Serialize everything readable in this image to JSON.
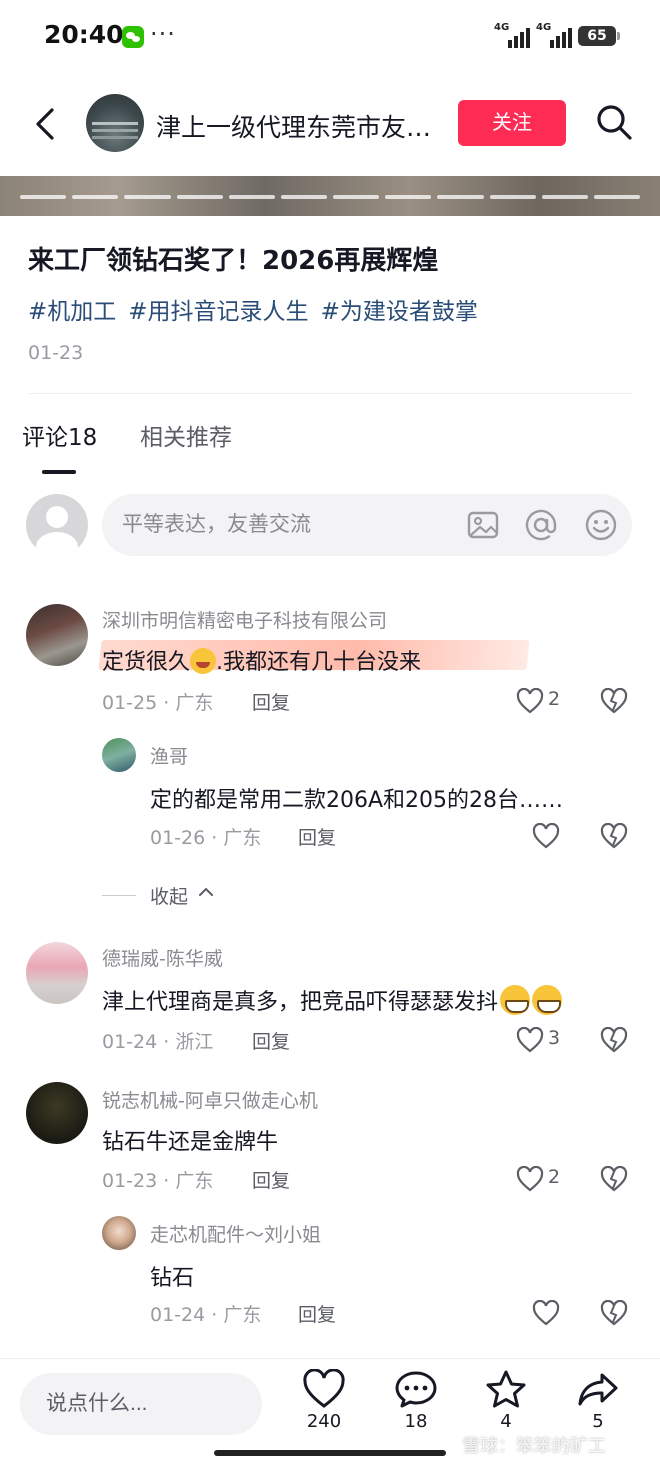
{
  "status": {
    "time": "20:40",
    "dots": "···",
    "signal_label": "4G",
    "battery": "65"
  },
  "header": {
    "title": "津上一级代理东莞市友…",
    "follow_label": "关注"
  },
  "post": {
    "title": "来工厂领钻石奖了！2026再展辉煌",
    "hashtags": [
      "#机加工",
      "#用抖音记录人生",
      "#为建设者鼓掌"
    ],
    "date": "01-23"
  },
  "tabs": {
    "comments": "评论18",
    "related": "相关推荐"
  },
  "composer": {
    "placeholder": "平等表达，友善交流"
  },
  "comments": [
    {
      "user": "深圳市明信精密电子科技有限公司",
      "text_a": "定货很久",
      "text_b": ".我都还有几十台没来",
      "date": "01-25",
      "location": "广东",
      "reply": "回复",
      "likes": "2"
    },
    {
      "user": "渔哥",
      "text": "定的都是常用二款206A和205的28台……",
      "date": "01-26",
      "location": "广东",
      "reply": "回复"
    },
    {
      "user": "德瑞威-陈华威",
      "text": "津上代理商是真多，把竞品吓得瑟瑟发抖",
      "date": "01-24",
      "location": "浙江",
      "reply": "回复",
      "likes": "3"
    },
    {
      "user": "锐志机械-阿卓只做走心机",
      "text": "钻石牛还是金牌牛",
      "date": "01-23",
      "location": "广东",
      "reply": "回复",
      "likes": "2"
    },
    {
      "user": "走芯机配件～刘小姐",
      "text": "钻石",
      "date": "01-24",
      "location": "广东",
      "reply": "回复"
    }
  ],
  "collapse_label": "收起",
  "meta_sep": " · ",
  "bottom": {
    "placeholder": "说点什么...",
    "likes": "240",
    "comments": "18",
    "favorites": "4",
    "shares": "5"
  },
  "watermark": "雪球：笨笨的矿工",
  "colors": {
    "accent": "#fe2c55",
    "hashtag": "#2a4d77"
  }
}
